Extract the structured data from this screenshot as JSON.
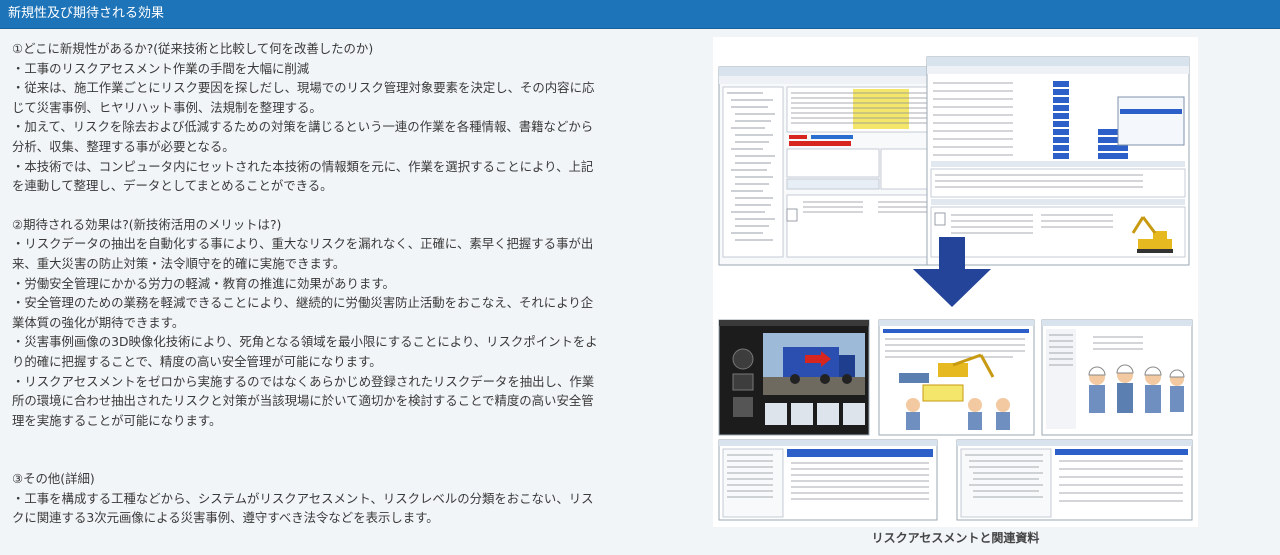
{
  "section": {
    "title": "新規性及び期待される効果"
  },
  "body": {
    "novelty_heading": "①どこに新規性があるか?(従来技術と比較して何を改善したのか)",
    "novelty_lines": [
      "・工事のリスクアセスメント作業の手間を大幅に削減",
      "・従来は、施工作業ごとにリスク要因を探しだし、現場でのリスク管理対象要素を決定し、その内容に応",
      "じて災害事例、ヒヤリハット事例、法規制を整理する。",
      "・加えて、リスクを除去および低減するための対策を講じるという一連の作業を各種情報、書籍などから",
      "分析、収集、整理する事が必要となる。",
      "・本技術では、コンピュータ内にセットされた本技術の情報類を元に、作業を選択することにより、上記",
      "を連動して整理し、データとしてまとめることができる。"
    ],
    "effects_heading": "②期待される効果は?(新技術活用のメリットは?)",
    "effects_lines": [
      "・リスクデータの抽出を自動化する事により、重大なリスクを漏れなく、正確に、素早く把握する事が出",
      "来、重大災害の防止対策・法令順守を的確に実施できます。",
      "・労働安全管理にかかる労力の軽減・教育の推進に効果があります。",
      "・安全管理のための業務を軽減できることにより、継続的に労働災害防止活動をおこなえ、それにより企",
      "業体質の強化が期待できます。",
      "・災害事例画像の3D映像化技術により、死角となる領域を最小限にすることにより、リスクポイントをよ",
      "り的確に把握することで、精度の高い安全管理が可能になります。",
      "・リスクアセスメントをゼロから実施するのではなくあらかじめ登録されたリスクデータを抽出し、作業",
      "所の環境に合わせ抽出されたリスクと対策が当該現場に於いて適切かを検討することで精度の高い安全管",
      "理を実施することが可能になります。"
    ],
    "other_heading": "③その他(詳細)",
    "other_lines": [
      "・工事を構成する工種などから、システムがリスクアセスメント、リスクレベルの分類をおこない、リス",
      "クに関連する3次元画像による災害事例、遵守すべき法令などを表示します。"
    ]
  },
  "figure": {
    "caption": "リスクアセスメントと関連資料",
    "icons": [
      "down-arrow-icon",
      "excavator-icon",
      "worker-icon"
    ],
    "colors": {
      "header": "#1e74b8",
      "arrow": "#24449a",
      "highlight": "#f4e66a",
      "select": "#2c5fc8",
      "truck": "#2a4fb0",
      "excavator": "#e7b920"
    }
  }
}
